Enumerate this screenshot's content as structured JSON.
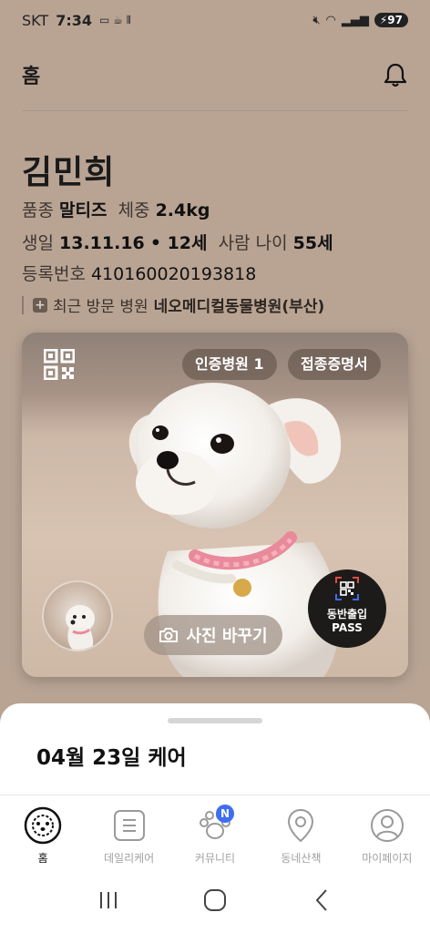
{
  "status_bar": {
    "carrier": "SKT",
    "time": "7:34",
    "battery": "97",
    "battery_icon_name": "charging-battery-icon"
  },
  "header": {
    "title": "홈"
  },
  "pet": {
    "name": "김민희",
    "breed_label": "품종",
    "breed": "말티즈",
    "weight_label": "체중",
    "weight": "2.4kg",
    "birth_label": "생일",
    "birth": "13.11.16",
    "age": "• 12세",
    "human_age_label": "사람 나이",
    "human_age": "55세",
    "reg_label": "등록번호",
    "reg_number": "410160020193818",
    "recent_visit_label": "최근 방문 병원",
    "recent_hospital": "네오메디컬동물병원(부산)"
  },
  "card": {
    "certified_hospital": "인증병원 1",
    "vaccination_cert": "접종증명서",
    "change_photo": "사진 바꾸기",
    "pass_line1": "동반출입",
    "pass_line2": "PASS"
  },
  "sheet": {
    "title": "04월 23일 케어"
  },
  "bottom_nav": {
    "items": [
      {
        "label": "홈",
        "icon": "dog-face-icon",
        "active": true
      },
      {
        "label": "데일리케어",
        "icon": "list-icon",
        "active": false
      },
      {
        "label": "커뮤니티",
        "icon": "paw-icon",
        "active": false,
        "badge": "N"
      },
      {
        "label": "동네산책",
        "icon": "location-pin-icon",
        "active": false
      },
      {
        "label": "마이페이지",
        "icon": "user-icon",
        "active": false
      }
    ]
  },
  "colors": {
    "background": "#b9a494",
    "badge": "#3d6df2",
    "pass_bg": "#1d1b1a"
  }
}
